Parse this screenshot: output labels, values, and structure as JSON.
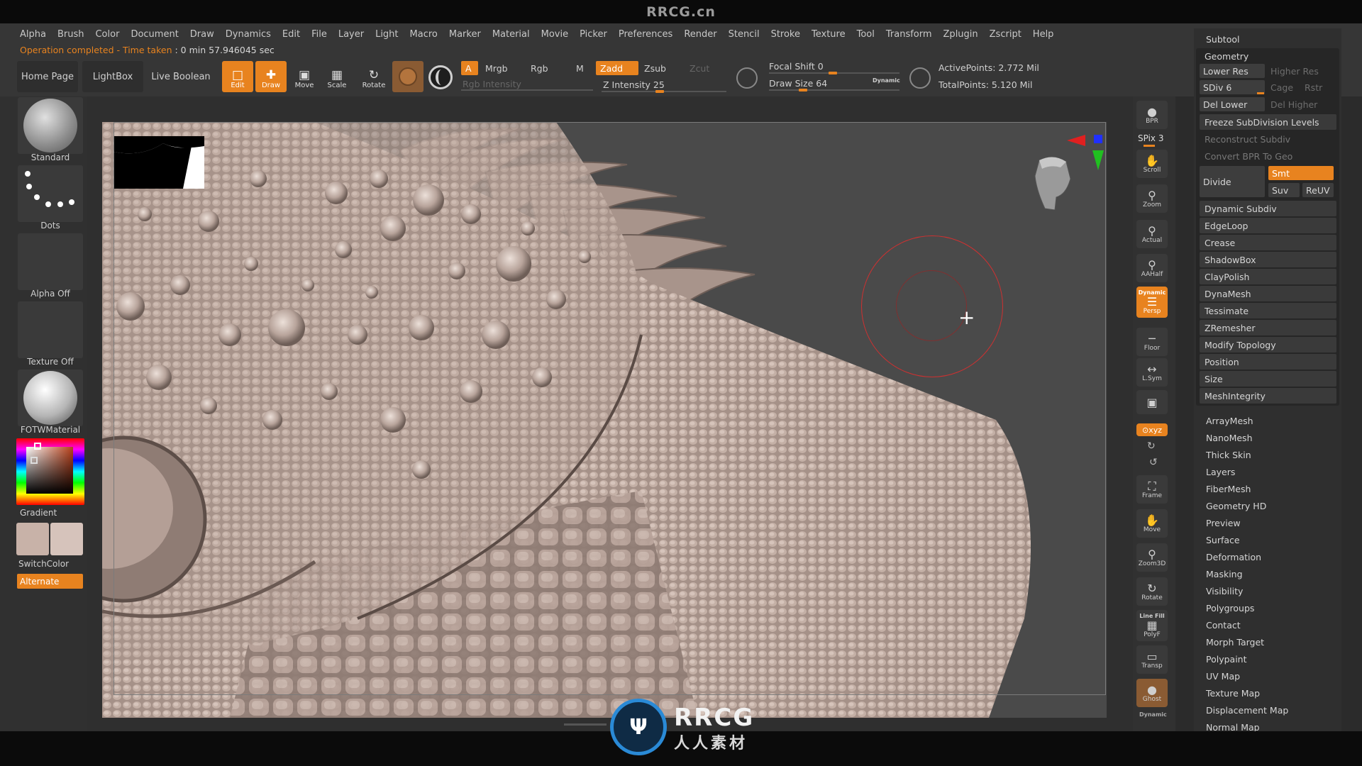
{
  "brand": "RRCG.cn",
  "menu": [
    "Alpha",
    "Brush",
    "Color",
    "Document",
    "Draw",
    "Dynamics",
    "Edit",
    "File",
    "Layer",
    "Light",
    "Macro",
    "Marker",
    "Material",
    "Movie",
    "Picker",
    "Preferences",
    "Render",
    "Stencil",
    "Stroke",
    "Texture",
    "Tool",
    "Transform",
    "Zplugin",
    "Zscript",
    "Help"
  ],
  "status": {
    "message": "Operation completed - Time taken",
    "time": ": 0 min 57.946045 sec"
  },
  "nav": {
    "home": "Home Page",
    "lightbox": "LightBox",
    "live_boolean": "Live Boolean"
  },
  "tools": {
    "edit": "Edit",
    "draw": "Draw",
    "move": "Move",
    "scale": "Scale",
    "rotate": "Rotate"
  },
  "color_mode": {
    "a": "A",
    "mrgb": "Mrgb",
    "rgb": "Rgb",
    "m": "M",
    "rgb_intensity": "Rgb Intensity"
  },
  "sculpt_mode": {
    "zadd": "Zadd",
    "zsub": "Zsub",
    "zcut": "Zcut",
    "z_intensity": "Z Intensity 25",
    "z_intensity_value": 25
  },
  "focal": {
    "focal_shift": "Focal Shift 0",
    "draw_size": "Draw Size 64",
    "dynamic": "Dynamic"
  },
  "stats": {
    "active": "ActivePoints: 2.772 Mil",
    "total": "TotalPoints: 5.120 Mil"
  },
  "left": {
    "brush": "Standard",
    "stroke": "Dots",
    "alpha": "Alpha Off",
    "texture": "Texture Off",
    "material": "FOTWMaterial",
    "gradient": "Gradient",
    "switch": "SwitchColor",
    "alternate": "Alternate"
  },
  "colors": {
    "accent": "#e8831f",
    "clay": "#b8a39b",
    "swatch_main": "#c8b2a8",
    "swatch_alt": "#d6c3bb"
  },
  "rightcol": {
    "bpr": "BPR",
    "spix": "SPix 3",
    "scroll": "Scroll",
    "zoom": "Zoom",
    "actual": "Actual",
    "aahalf": "AAHalf",
    "dynamic": "Dynamic",
    "persp": "Persp",
    "floor": "Floor",
    "lsym": "L.Sym",
    "xyz": "⊙xyz",
    "frame": "Frame",
    "move": "Move",
    "zoom3d": "Zoom3D",
    "rotate": "Rotate",
    "line_fill": "Line Fill",
    "polyf": "PolyF",
    "transp": "Transp",
    "ghost": "Ghost",
    "dynamic2": "Dynamic"
  },
  "panel": {
    "subtool": "Subtool",
    "geometry": "Geometry",
    "lower_res": "Lower Res",
    "higher_res": "Higher Res",
    "sdiv": "SDiv 6",
    "cage": "Cage",
    "rstr": "Rstr",
    "del_lower": "Del Lower",
    "del_higher": "Del Higher",
    "freeze": "Freeze SubDivision Levels",
    "reconstruct": "Reconstruct Subdiv",
    "convert": "Convert BPR To Geo",
    "divide": "Divide",
    "smt": "Smt",
    "suv": "Suv",
    "reuv": "ReUV",
    "geometry_items": [
      "Dynamic Subdiv",
      "EdgeLoop",
      "Crease",
      "ShadowBox",
      "ClayPolish",
      "DynaMesh",
      "Tessimate",
      "ZRemesher",
      "Modify Topology",
      "Position",
      "Size",
      "MeshIntegrity"
    ],
    "sections": [
      "ArrayMesh",
      "NanoMesh",
      "Thick Skin",
      "Layers",
      "FiberMesh",
      "Geometry HD",
      "Preview",
      "Surface",
      "Deformation",
      "Masking",
      "Visibility",
      "Polygroups",
      "Contact",
      "Morph Target",
      "Polypaint",
      "UV Map",
      "Texture Map",
      "Displacement Map",
      "Normal Map"
    ]
  },
  "watermark": {
    "logo": "RRCG",
    "sub": "人人素材"
  }
}
